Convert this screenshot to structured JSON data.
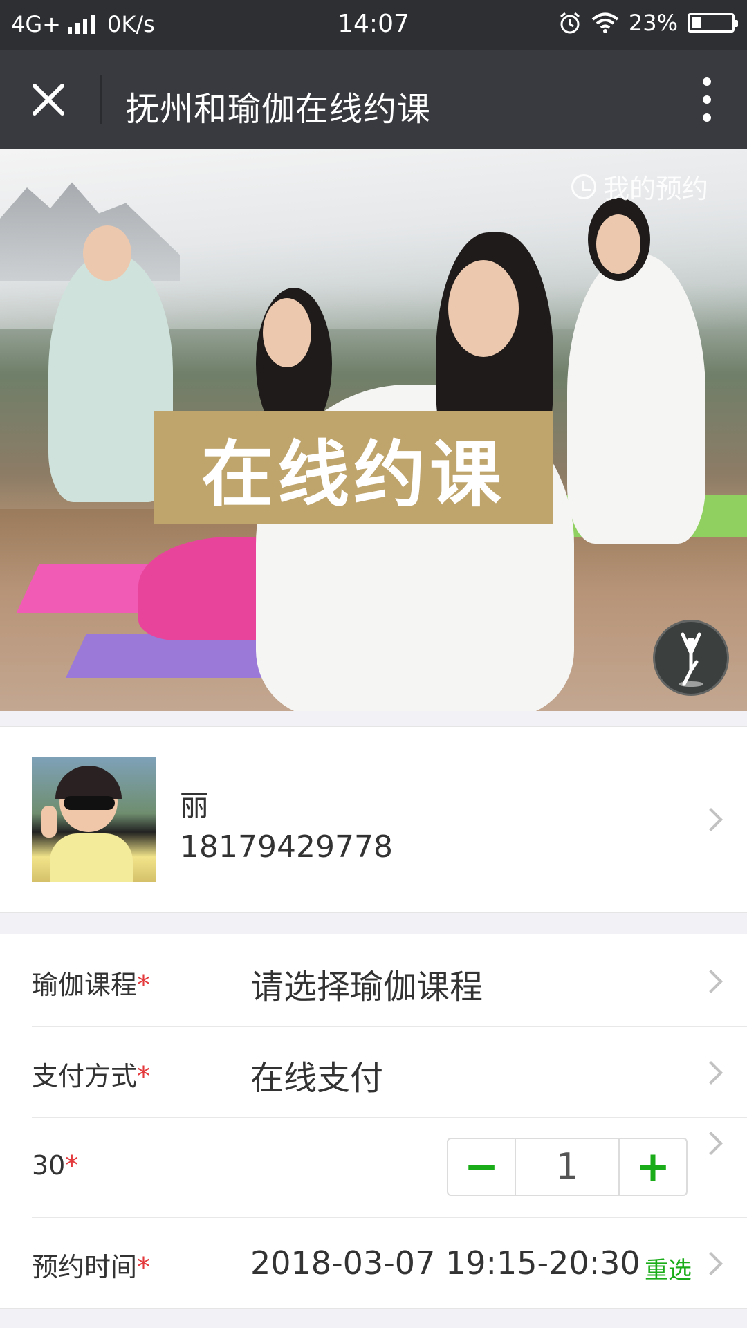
{
  "status_bar": {
    "network": "4G+",
    "speed": "0K/s",
    "time": "14:07",
    "battery": "23%",
    "battery_level": 0.23
  },
  "title_bar": {
    "title": "抚州和瑜伽在线约课"
  },
  "banner": {
    "caption": "在线约课",
    "my_booking": "我的预约"
  },
  "user": {
    "name": "丽",
    "phone": "18179429778"
  },
  "form": {
    "course": {
      "label": "瑜伽课程",
      "required": "*",
      "value": "请选择瑜伽课程"
    },
    "payment": {
      "label": "支付方式",
      "required": "*",
      "value": "在线支付"
    },
    "quantity": {
      "label": "30",
      "required": "*",
      "minus": "−",
      "value": "1",
      "plus": "+"
    },
    "time": {
      "label": "预约时间",
      "required": "*",
      "value": "2018-03-07 19:15-20:30",
      "reselect": "重选"
    }
  },
  "colors": {
    "status_bar_bg": "#2d2f33",
    "title_bar_bg": "#393a3f",
    "accent_green": "#1aad19",
    "required_red": "#e4393c",
    "caption_bg": "#bfa46c"
  }
}
